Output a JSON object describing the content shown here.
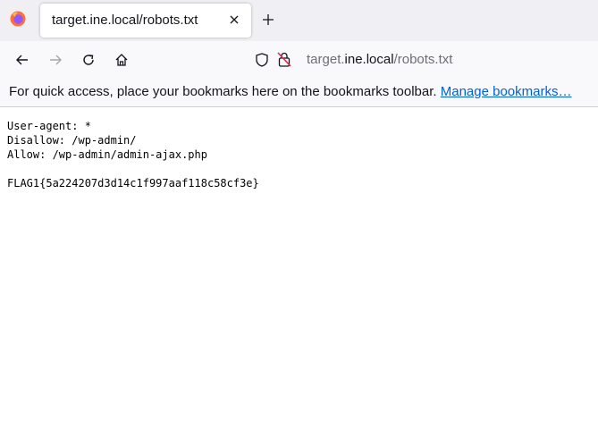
{
  "browser": {
    "tab": {
      "title": "target.ine.local/robots.txt"
    },
    "url": {
      "domain_prefix": "target.",
      "domain": "ine.local",
      "path": "/robots.txt"
    },
    "bookmarks_bar": {
      "text": "For quick access, place your bookmarks here on the bookmarks toolbar.",
      "link_label": "Manage bookmarks…"
    },
    "icons": [
      "firefox-logo-icon",
      "close-icon",
      "plus-icon",
      "back-arrow-icon",
      "forward-arrow-icon",
      "reload-icon",
      "home-icon",
      "shield-icon",
      "insecure-lock-icon"
    ],
    "colors": {
      "link": "#0061e0",
      "tabbar_bg": "#f0f0f4",
      "toolbar_bg": "#f9f9fb"
    }
  },
  "page": {
    "lines": [
      "User-agent: *",
      "Disallow: /wp-admin/",
      "Allow: /wp-admin/admin-ajax.php",
      "",
      "FLAG1{5a224207d3d14c1f997aaf118c58cf3e}"
    ]
  }
}
